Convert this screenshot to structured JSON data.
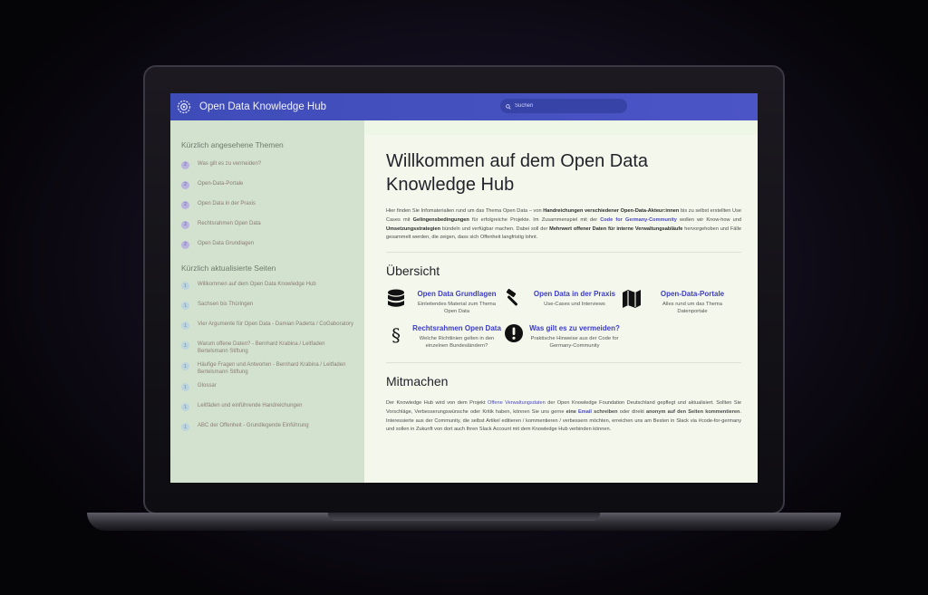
{
  "colors": {
    "topbar": "#4450c0",
    "accent": "#3d3cc4",
    "sidebar_bg": "#d3e2ce",
    "main_bg": "#f4f8ec"
  },
  "header": {
    "title": "Open Data Knowledge Hub",
    "logo_icon": "gear-logo",
    "search_icon": "search-icon",
    "search_placeholder": "Suchen"
  },
  "sidebar": {
    "recent_heading": "Kürzlich angesehene Themen",
    "recent": [
      {
        "label": "Was gilt es zu vermeiden?"
      },
      {
        "label": "Open-Data-Portale"
      },
      {
        "label": "Open Data in der Praxis"
      },
      {
        "label": "Rechtsrahmen Open Data"
      },
      {
        "label": "Open Data Grundlagen"
      }
    ],
    "updated_heading": "Kürzlich aktualisierte Seiten",
    "updated": [
      {
        "label": "Willkommen auf dem Open Data Knowledge Hub"
      },
      {
        "label": "Sachsen bis Thüringen"
      },
      {
        "label": "Vier Argumente für Open Data - Damian Paderta / CoGaboratory"
      },
      {
        "label": "Warum offene Daten? - Bernhard Krabina / Leitfaden Bertelsmann Stiftung"
      },
      {
        "label": "Häufige Fragen und Antworten - Bernhard Krabina / Leitfaden Bertelsmann Stiftung"
      },
      {
        "label": "Glossar"
      },
      {
        "label": "Leitfäden und einführende Handreichungen"
      },
      {
        "label": "ABC der Offenheit - Grundlegende Einführung"
      }
    ]
  },
  "main": {
    "title": "Willkommen auf dem Open Data Knowledge Hub",
    "intro": {
      "t1": "Hier finden Sie Infomaterialien rund um das Thema Open Data – von ",
      "b1": "Handreichungen verschiedener Open-Data-Akteur:innen",
      "t2": " bis zu selbst erstellten Use Cases mit ",
      "b2": "Gelingensbedingungen",
      "t3": " für erfolgreiche Projekte. Im Zusammenspiel mit der ",
      "link1": "Code for Germany-Community",
      "t4": " wollen wir Know-how und ",
      "b3": "Umsetzungsstrategien",
      "t5": " bündeln und verfügbar machen. Dabei soll der ",
      "b4": "Mehrwert offener Daten für interne Verwaltungsabläufe",
      "t6": " hervorgehoben und Fälle gesammelt werden, die zeigen, dass sich Offenheit langfristig lohnt."
    },
    "overview_title": "Übersicht",
    "cards": [
      {
        "icon": "database-icon",
        "title": "Open Data Grundlagen",
        "desc": "Einleitendes Material zum Thema Open Data"
      },
      {
        "icon": "hammer-icon",
        "title": "Open Data in der Praxis",
        "desc": "Use-Cases und Interviews"
      },
      {
        "icon": "map-icon",
        "title": "Open-Data-Portale",
        "desc": "Alles rund um das Thema Datenportale"
      },
      {
        "icon": "paragraph-icon",
        "title": "Rechtsrahmen Open Data",
        "desc": "Welche Richtlinien gelten in den einzelnen Bundesländern?"
      },
      {
        "icon": "warning-icon",
        "title": "Was gilt es zu vermeiden?",
        "desc": "Praktische Hinweise aus der Code for Germany-Community"
      }
    ],
    "mitmachen_title": "Mitmachen",
    "mitmachen": {
      "t1": "Der Knowledge Hub wird von dem Projekt ",
      "link1": "Offene Verwaltungsdaten",
      "t2": " der Open Knowledge Foundation Deutschland gepflegt und aktualisiert. Sollten Sie Vorschläge, Verbesserungswünsche oder Kritik haben, können Sie uns gerne ",
      "b1": "eine ",
      "link2": "Email",
      "b2": " schreiben",
      "t3": " oder direkt ",
      "b3": "anonym auf den Seiten kommentieren",
      "t4": ". Interessierte aus der Community, die selbst Artikel editieren / kommentieren / verbessern möchten, erreichen uns am Besten in Slack via #code-for-germany und sollen in Zukunft von dort auch Ihren Slack Account mit dem Knowledge Hub verbinden können."
    }
  }
}
